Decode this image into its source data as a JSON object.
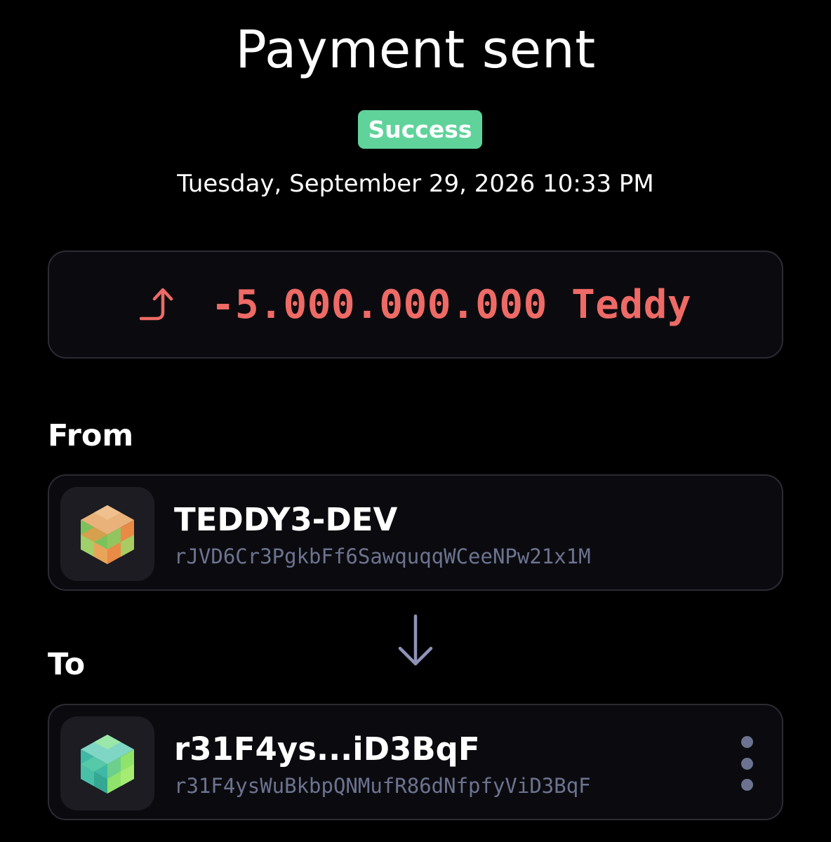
{
  "header": {
    "title": "Payment sent",
    "status_badge": "Success",
    "datetime": "Tuesday, September 29, 2026 10:33 PM"
  },
  "amount": {
    "direction_icon": "arrow-up-outgoing-icon",
    "value": "-5.000.000.000 Teddy",
    "color": "#ee6a66"
  },
  "from": {
    "label": "From",
    "account_name": "TEDDY3-DEV",
    "address": "rJVD6Cr3PgkbFf6SawquqqWCeeNPw21x1M",
    "avatar_icon": "orange-green-cube-avatar-icon"
  },
  "transfer_icon": "arrow-down-icon",
  "to": {
    "label": "To",
    "account_name": "r31F4ys...iD3BqF",
    "address": "r31F4ysWuBkbpQNMufR86dNfpfyViD3BqF",
    "avatar_icon": "teal-green-cube-avatar-icon",
    "more_icon": "more-vertical-icon"
  },
  "colors": {
    "background": "#000000",
    "success": "#5fd39a",
    "negative_amount": "#ee6a66",
    "muted_address": "#6c7390",
    "card_border": "#2b2b33"
  }
}
